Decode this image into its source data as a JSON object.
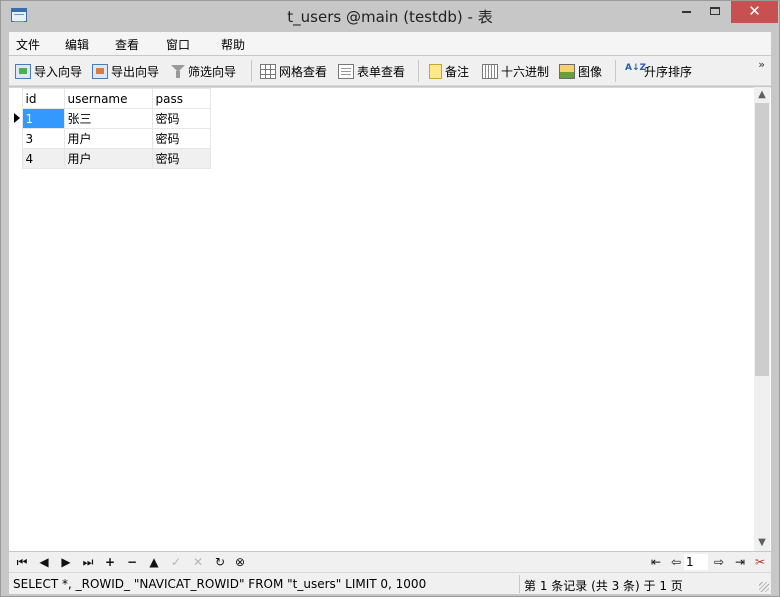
{
  "window": {
    "title": "t_users @main (testdb) - 表",
    "close_glyph": "✕"
  },
  "menu": {
    "items": [
      "文件",
      "编辑",
      "查看",
      "窗口",
      "帮助"
    ]
  },
  "toolbar": {
    "import_wizard": "导入向导",
    "export_wizard": "导出向导",
    "filter_wizard": "筛选向导",
    "grid_view": "网格查看",
    "form_view": "表单查看",
    "memo": "备注",
    "hex": "十六进制",
    "image": "图像",
    "sort_asc": "升序排序",
    "sort_icon_text": "A↓Z",
    "more": "»"
  },
  "table": {
    "columns": [
      "id",
      "username",
      "pass"
    ],
    "rows": [
      {
        "id": "1",
        "username": "张三",
        "pass": "密码"
      },
      {
        "id": "3",
        "username": "用户",
        "pass": "密码"
      },
      {
        "id": "4",
        "username": "用户",
        "pass": "密码"
      }
    ],
    "selected_row_index": 0
  },
  "scrollbar": {
    "up": "▲",
    "down": "▼"
  },
  "navigator": {
    "first": "⏮",
    "prev": "◀",
    "next": "▶",
    "last": "⏭",
    "add": "+",
    "delete": "−",
    "up": "▲",
    "apply": "✓",
    "discard": "✕",
    "refresh": "↻",
    "stop": "⊗",
    "page_first": "⇤",
    "page_prev": "⇦",
    "page_number": "1",
    "page_next": "⇨",
    "page_last": "⇥",
    "settings": "✂"
  },
  "status": {
    "sql": "SELECT *, _ROWID_ \"NAVICAT_ROWID\" FROM \"t_users\" LIMIT 0, 1000",
    "record_info": "第 1 条记录 (共 3 条) 于 1 页"
  }
}
